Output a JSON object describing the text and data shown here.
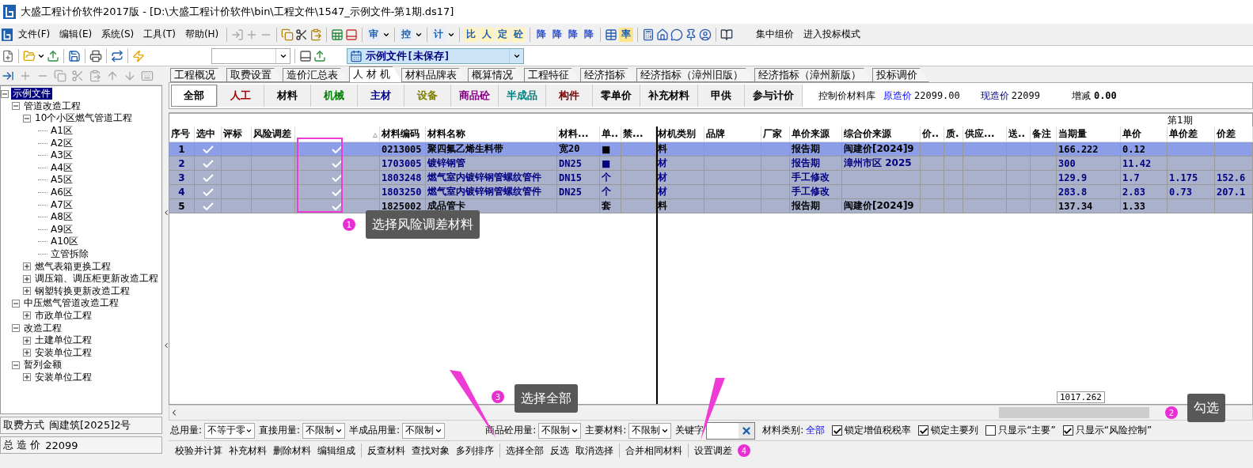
{
  "window": {
    "title": "大盛工程计价软件2017版 - [D:\\大盛工程计价软件\\bin\\工程文件\\1547_示例文件-第1期.ds17]"
  },
  "menu": [
    "文件(F)",
    "编辑(E)",
    "系统(S)",
    "工具(T)",
    "帮助(H)"
  ],
  "toolbar": {
    "menu_glyphs": [
      "审",
      "控",
      "计"
    ],
    "glyphs": [
      "比",
      "人",
      "定",
      "砼"
    ],
    "drop_glyphs": [
      "降",
      "降",
      "降",
      "降"
    ],
    "rate_glyph": "率",
    "actions": [
      "集中组价",
      "进入投标模式"
    ]
  },
  "file_selector": {
    "value": "示例文件[未保存]"
  },
  "tree": [
    {
      "label": "示例文件",
      "selected": true,
      "expanded": true,
      "children": [
        {
          "label": "管道改造工程",
          "selected": false,
          "expanded": true,
          "children": [
            {
              "label": "10个小区燃气管道工程",
              "selected": false,
              "expanded": true,
              "children": [
                {
                  "label": "A1区",
                  "selected": false
                },
                {
                  "label": "A2区",
                  "selected": false
                },
                {
                  "label": "A3区",
                  "selected": false
                },
                {
                  "label": "A4区",
                  "selected": false
                },
                {
                  "label": "A5区",
                  "selected": false
                },
                {
                  "label": "A6区",
                  "selected": false
                },
                {
                  "label": "A7区",
                  "selected": false
                },
                {
                  "label": "A8区",
                  "selected": false
                },
                {
                  "label": "A9区",
                  "selected": false
                },
                {
                  "label": "A10区",
                  "selected": false
                },
                {
                  "label": "立管拆除",
                  "selected": false
                }
              ]
            },
            {
              "label": "燃气表箱更换工程",
              "selected": false,
              "expanded": false
            },
            {
              "label": "调压箱、调压柜更新改造工程",
              "selected": false,
              "expanded": false
            },
            {
              "label": "钢塑转换更新改造工程",
              "selected": false,
              "expanded": false
            }
          ]
        },
        {
          "label": "中压燃气管道改造工程",
          "selected": false,
          "expanded": true,
          "children": [
            {
              "label": "市政单位工程",
              "selected": false,
              "expanded": false
            }
          ]
        },
        {
          "label": "改造工程",
          "selected": false,
          "expanded": true,
          "children": [
            {
              "label": "土建单位工程",
              "selected": false,
              "expanded": false
            },
            {
              "label": "安装单位工程",
              "selected": false,
              "expanded": false
            }
          ]
        },
        {
          "label": "暂列金额",
          "selected": false,
          "expanded": true,
          "children": [
            {
              "label": "安装单位工程",
              "selected": false,
              "expanded": false
            }
          ]
        }
      ]
    }
  ],
  "project_info": [
    {
      "label": "取费方式",
      "value": "闽建筑[2025]2号"
    },
    {
      "label": "总 造 价",
      "value": "22099"
    }
  ],
  "sheet_tabs": [
    {
      "label": "工程概况",
      "selected": false
    },
    {
      "label": "取费设置",
      "selected": false
    },
    {
      "label": "造价汇总表",
      "selected": false
    },
    {
      "label": "人 材 机",
      "selected": true
    },
    {
      "label": "材料品牌表",
      "selected": false
    },
    {
      "label": "概算情况",
      "selected": false
    },
    {
      "label": "工程特征",
      "selected": false
    },
    {
      "label": "经济指标",
      "selected": false
    },
    {
      "label": "经济指标（漳州旧版）",
      "selected": false
    },
    {
      "label": "经济指标（漳州新版）",
      "selected": false
    },
    {
      "label": "投标调价",
      "selected": false
    }
  ],
  "category_tabs": [
    {
      "label": "全部",
      "color": "#000000",
      "selected": true
    },
    {
      "label": "人工",
      "color": "#a00000",
      "selected": false
    },
    {
      "label": "材料",
      "color": "#000000",
      "selected": false
    },
    {
      "label": "机械",
      "color": "#008000",
      "selected": false
    },
    {
      "label": "主材",
      "color": "#000080",
      "selected": false
    },
    {
      "label": "设备",
      "color": "#808000",
      "selected": false
    },
    {
      "label": "商品砼",
      "color": "#800080",
      "selected": false
    },
    {
      "label": "半成品",
      "color": "#008080",
      "selected": false
    },
    {
      "label": "构件",
      "color": "#800000",
      "selected": false
    },
    {
      "label": "零单价",
      "color": "#000000",
      "selected": false
    },
    {
      "label": "补充材料",
      "color": "#000000",
      "selected": false
    },
    {
      "label": "甲供",
      "color": "#000000",
      "selected": false
    },
    {
      "label": "参与计价",
      "color": "#000000",
      "selected": false
    }
  ],
  "price_info": {
    "library": "控制价材料库",
    "original_label": "原造价",
    "original_value": "22099.00",
    "current_label": "现造价",
    "current_value": "22099",
    "change_label": "增减",
    "change_value": "0.00"
  },
  "table": {
    "group_header": "第1期",
    "columns": [
      {
        "label": "序号",
        "kind": "text"
      },
      {
        "label": "选中",
        "kind": "check"
      },
      {
        "label": "评标",
        "kind": "text"
      },
      {
        "label": "风险调差",
        "kind": "text"
      },
      {
        "label": "▵",
        "kind": "check"
      },
      {
        "label": "材料编码",
        "kind": "text"
      },
      {
        "label": "材料名称",
        "kind": "text"
      },
      {
        "label": "材料...",
        "kind": "text"
      },
      {
        "label": "单..",
        "kind": "text"
      },
      {
        "label": "禁...",
        "kind": "text"
      },
      {
        "label": "材机类别",
        "kind": "text"
      },
      {
        "label": "品牌",
        "kind": "text"
      },
      {
        "label": "厂家",
        "kind": "text"
      },
      {
        "label": "单价来源",
        "kind": "text"
      },
      {
        "label": "综合价来源",
        "kind": "text"
      },
      {
        "label": "价..",
        "kind": "text"
      },
      {
        "label": "质.",
        "kind": "text"
      },
      {
        "label": "供应...",
        "kind": "text"
      },
      {
        "label": "送..",
        "kind": "text"
      },
      {
        "label": "备注",
        "kind": "text"
      },
      {
        "label": "当期量",
        "kind": "text"
      },
      {
        "label": "单价",
        "kind": "text"
      },
      {
        "label": "单价差",
        "kind": "text"
      },
      {
        "label": "价差",
        "kind": "text"
      }
    ],
    "rows": [
      {
        "selected": true,
        "cells": [
          "1",
          true,
          null,
          null,
          true,
          "0213005",
          "聚四氟乙烯生料带",
          "宽20",
          "■",
          null,
          "料",
          null,
          null,
          "报告期",
          "闽建价[2024]9",
          null,
          null,
          null,
          null,
          null,
          "166.222",
          "0.12",
          null,
          null
        ]
      },
      {
        "selected": false,
        "color": "#000080",
        "cells": [
          "2",
          true,
          null,
          null,
          true,
          "1703005",
          "镀锌钢管",
          "DN25",
          "■",
          null,
          "材",
          null,
          null,
          "报告期",
          "漳州市区 2025",
          null,
          null,
          null,
          null,
          null,
          "300",
          "11.42",
          null,
          null
        ]
      },
      {
        "selected": false,
        "color": "#000080",
        "cells": [
          "3",
          true,
          null,
          null,
          true,
          "1803248",
          "燃气室内镀锌钢管螺纹管件",
          "DN15",
          "个",
          null,
          "材",
          null,
          null,
          "手工修改",
          null,
          null,
          null,
          null,
          null,
          null,
          "129.9",
          "1.7",
          "1.175",
          "152.6"
        ]
      },
      {
        "selected": false,
        "color": "#000080",
        "cells": [
          "4",
          true,
          null,
          null,
          true,
          "1803250",
          "燃气室内镀锌钢管螺纹管件",
          "DN25",
          "个",
          null,
          "材",
          null,
          null,
          "手工修改",
          null,
          null,
          null,
          null,
          null,
          null,
          "283.8",
          "2.83",
          "0.73",
          "207.1"
        ]
      },
      {
        "selected": false,
        "color": "#000000",
        "cells": [
          "5",
          true,
          null,
          null,
          true,
          "1825002",
          "成品管卡",
          null,
          "套",
          null,
          "料",
          null,
          null,
          "报告期",
          "闽建价[2024]9",
          null,
          null,
          null,
          null,
          null,
          "137.34",
          "1.33",
          null,
          null
        ]
      }
    ],
    "total": "1017.262"
  },
  "filters": [
    {
      "label": "总用量:",
      "value": "不等于零"
    },
    {
      "label": "直接用量:",
      "value": "不限制"
    },
    {
      "label": "半成品用量:",
      "value": "不限制"
    },
    {
      "label": "商品砼用量:",
      "value": "不限制"
    },
    {
      "label": "主要材料:",
      "value": "不限制"
    }
  ],
  "keyword": {
    "label": "关键字"
  },
  "category": {
    "label": "材料类别:",
    "value": "全部"
  },
  "options": [
    {
      "label": "锁定增值税税率",
      "checked": true
    },
    {
      "label": "锁定主要列",
      "checked": true
    },
    {
      "label": "只显示“主要”",
      "checked": false
    },
    {
      "label": "只显示“风险控制”",
      "checked": true
    }
  ],
  "actions": [
    [
      "校验并计算",
      "补充材料",
      "删除材料",
      "编辑组成"
    ],
    [
      "反查材料",
      "查找对象",
      "多列排序"
    ],
    [
      "选择全部",
      "反选",
      "取消选择"
    ],
    [
      "合并相同材料"
    ],
    [
      "设置调差"
    ]
  ],
  "callouts": [
    {
      "number": "1",
      "text": "选择风险调差材料"
    },
    {
      "number": "2",
      "text": "勾选"
    },
    {
      "number": "3",
      "text": "选择全部"
    },
    {
      "number": "4"
    }
  ]
}
